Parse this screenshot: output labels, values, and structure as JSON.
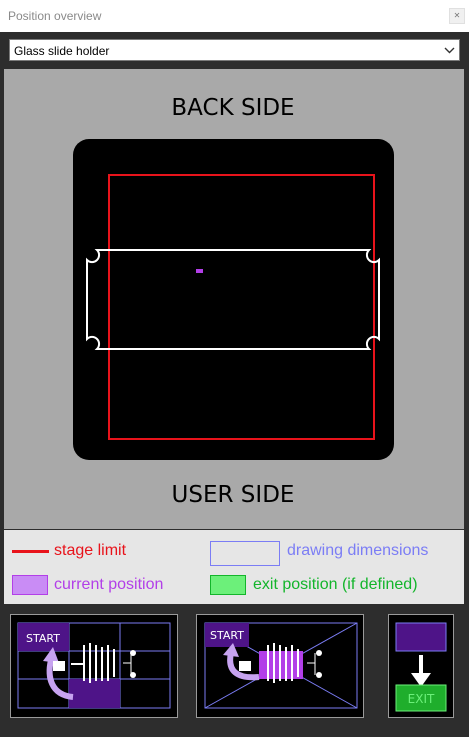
{
  "window": {
    "title": "Position overview",
    "close_icon": "close-icon"
  },
  "holder_select": {
    "value": "Glass slide holder",
    "options": [
      "Glass slide holder"
    ]
  },
  "stage": {
    "back_label": "BACK SIDE",
    "user_label": "USER SIDE"
  },
  "legend": {
    "stage_limit": {
      "label": "stage limit",
      "color": "#e8131b"
    },
    "drawing_dimensions": {
      "label": "drawing dimensions",
      "color": "#7b7df5"
    },
    "current_position": {
      "label": "current position",
      "color": "#b23fe8",
      "fill": "#c98cf5"
    },
    "exit_position": {
      "label": "exit position (if defined)",
      "color": "#13b52b",
      "fill": "#6cf07a"
    }
  },
  "thumbnails": {
    "start_label_1": "START",
    "start_label_2": "START",
    "exit_label": "EXIT"
  },
  "colors": {
    "purple_dark": "#4e1488",
    "purple_light": "#c7a3f0",
    "green_exit": "#1fae2c",
    "blue_grid": "#7b7df5",
    "stage_bg": "#a9a9a9",
    "legend_bg": "#e6e6e6"
  }
}
